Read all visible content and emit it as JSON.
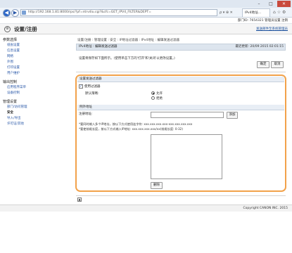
{
  "browser": {
    "url": "http://192.168.1.81:8000/rps/?pf=ntrvdiu.cgi?&cfc=GET_IPV4_FILTER&DEPT=",
    "tab_title": "IPv4地址…",
    "window_controls": {
      "min": "–",
      "max": "□",
      "close": "✕"
    },
    "nav": {
      "back": "◀",
      "forward": "▶"
    },
    "addr_controls": "ρ ▾ ⊕ ✕",
    "toolbar_icons": "⌂ ☆ ⚙"
  },
  "header": {
    "user_info": "部门ID: 7654321  管理员设置  注销",
    "app_title": "设置/注册",
    "send_admin_link": "发送邮件至系统管理员"
  },
  "sidebar": {
    "sections": [
      {
        "label": "参数选择",
        "items": [
          "纸张设置",
          "信息设置",
          "网络",
          "外围",
          "打印设置",
          "用户维护"
        ]
      },
      {
        "label": "输出控制",
        "items": [
          "应用程序菜单",
          "设备控制"
        ]
      },
      {
        "label": "管理设置",
        "items": [
          "部门/访问管理",
          "安全",
          "导入/导出",
          "许可证/其他"
        ]
      }
    ],
    "active_item": "安全"
  },
  "main": {
    "breadcrumb": "设置/注册 : 管理设置 : 安全 : IP地址过滤器 : IPv4地址 : 编辑发送过滤器",
    "heading": "IPv4地址 : 编辑发送过滤器",
    "last_updated": "最近更新: 20/09 2015 02:01:15",
    "instructions": "设置将保存如下面所示。(使用单击下方的'打开'和'关闭'以更改设置。)",
    "ok_label": "确定",
    "cancel_label": "取消",
    "filter_section_title": "设置发送过滤器",
    "use_filter_label": "使用过滤器",
    "use_filter_checked": "✓",
    "default_policy_label": "默认策略:",
    "policy_options": [
      "允许",
      "拒绝"
    ],
    "policy_selected": "允许",
    "exception_section_title": "例外地址",
    "register_label": "注册地址:",
    "register_value": "",
    "add_label": "添加",
    "note1": "*要同时输入多个IP地址，按以下方式使用连字符: xxx.xxx.xxx.xxx-xxx.xxx.xxx.xxx",
    "note2": "*要使前缀长度，按以下方式输入IP地址: xxx.xxx.xxx.xxx/xx(前缀长度: 0-32)",
    "delete_label": "删除",
    "top_icon": "▲"
  },
  "footer": {
    "copyright": "Copyright CANON INC. 2015"
  },
  "colors": {
    "panel_border": "#f2a24a",
    "link": "#2a58a8",
    "section_header_bg": "#e8eef5"
  }
}
